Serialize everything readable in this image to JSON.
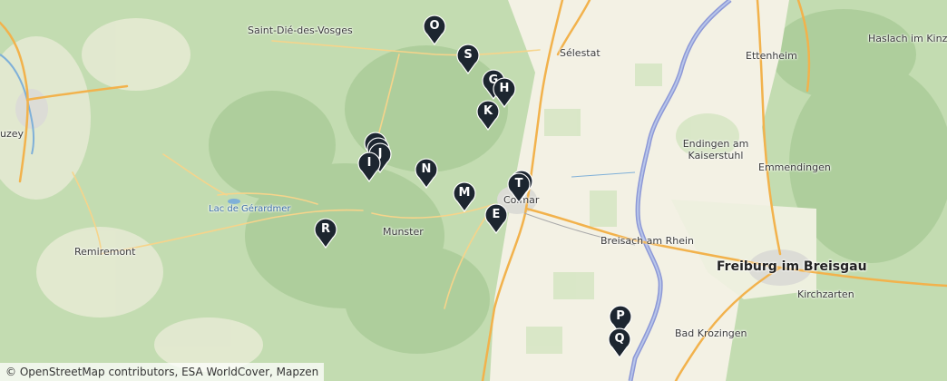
{
  "places": [
    {
      "id": "saint-die",
      "name": "Saint-Dié-des-Vosges"
    },
    {
      "id": "selestat",
      "name": "Sélestat"
    },
    {
      "id": "haslach",
      "name": "Haslach im Kinz"
    },
    {
      "id": "ettenheim",
      "name": "Ettenheim"
    },
    {
      "id": "endingen",
      "name": "Endingen am Kaiserstuhl"
    },
    {
      "id": "emmendingen",
      "name": "Emmendingen"
    },
    {
      "id": "gerardmer",
      "name": "Lac de Gérardmer"
    },
    {
      "id": "remiremont",
      "name": "Remiremont"
    },
    {
      "id": "munster",
      "name": "Munster"
    },
    {
      "id": "colmar",
      "name": "Colmar"
    },
    {
      "id": "breisach",
      "name": "Breisach am Rhein"
    },
    {
      "id": "freiburg",
      "name": "Freiburg im Breisgau"
    },
    {
      "id": "kirchzarten",
      "name": "Kirchzarten"
    },
    {
      "id": "bad-krozingen",
      "name": "Bad Krozingen"
    },
    {
      "id": "epinal-partial",
      "name": "uzey"
    }
  ],
  "markers": [
    {
      "label": "O"
    },
    {
      "label": "S"
    },
    {
      "label": "G"
    },
    {
      "label": "H"
    },
    {
      "label": "K"
    },
    {
      "label": ""
    },
    {
      "label": ""
    },
    {
      "label": "J"
    },
    {
      "label": "I"
    },
    {
      "label": "N"
    },
    {
      "label": "M"
    },
    {
      "label": ""
    },
    {
      "label": "T"
    },
    {
      "label": "E"
    },
    {
      "label": "R"
    },
    {
      "label": "P"
    },
    {
      "label": "Q"
    }
  ],
  "attribution": "© OpenStreetMap contributors, ESA WorldCover, Mapzen",
  "colors": {
    "forest": "#b9d6a8",
    "open_land": "#f3f1e4",
    "river": "#8d98d6",
    "road": "#f2b24c",
    "marker": "#1d2630"
  }
}
